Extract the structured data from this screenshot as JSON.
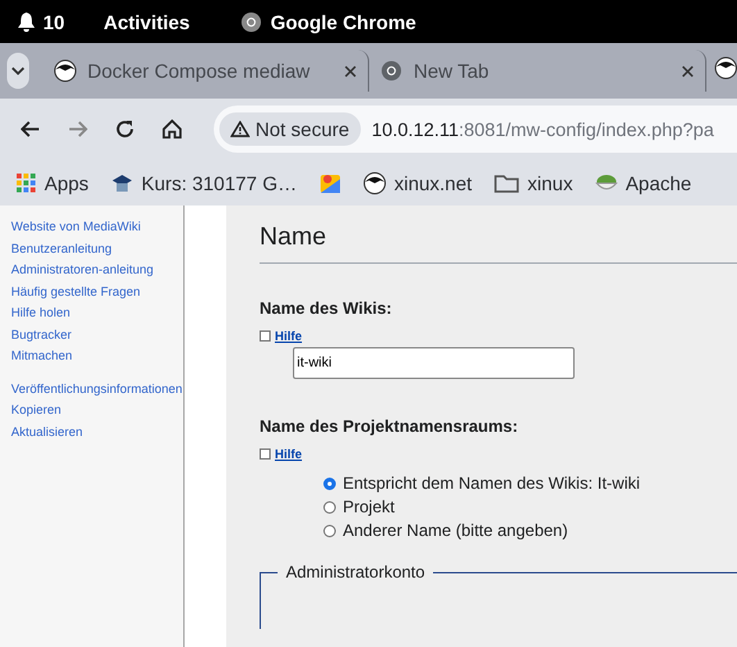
{
  "top_bar": {
    "notifications": "10",
    "activities": "Activities",
    "app": "Google Chrome"
  },
  "tabs": [
    {
      "title": "Docker Compose mediaw",
      "kind": "site"
    },
    {
      "title": "New Tab",
      "kind": "chrome"
    }
  ],
  "address": {
    "security": "Not secure",
    "host": "10.0.12.11",
    "rest": ":8081/mw-config/index.php?pa"
  },
  "bookmarks": [
    {
      "label": "Apps",
      "kind": "apps"
    },
    {
      "label": "Kurs: 310177 G…",
      "kind": "course"
    },
    {
      "kind": "maps"
    },
    {
      "label": "xinux.net",
      "kind": "site"
    },
    {
      "label": "xinux",
      "kind": "folder"
    },
    {
      "label": "Apache",
      "kind": "bowl"
    }
  ],
  "sidebar": {
    "groups": [
      [
        "Website von MediaWiki",
        "Benutzeranleitung",
        "Administratoren-anleitung",
        "Häufig gestellte Fragen",
        "Hilfe holen",
        "Bugtracker",
        "Mitmachen"
      ],
      [
        "Veröffentlichungsinformationen",
        "Kopieren",
        "Aktualisieren"
      ]
    ]
  },
  "content": {
    "heading": "Name",
    "wiki_name": {
      "label": "Name des Wikis:",
      "help": "Hilfe",
      "value": "it-wiki"
    },
    "namespace": {
      "label": "Name des Projektnamensraums:",
      "help": "Hilfe",
      "options": [
        {
          "label": "Entspricht dem Namen des Wikis: It-wiki",
          "selected": true
        },
        {
          "label": "Projekt",
          "selected": false
        },
        {
          "label": "Anderer Name (bitte angeben)",
          "selected": false
        }
      ]
    },
    "fieldset": "Administratorkonto"
  }
}
